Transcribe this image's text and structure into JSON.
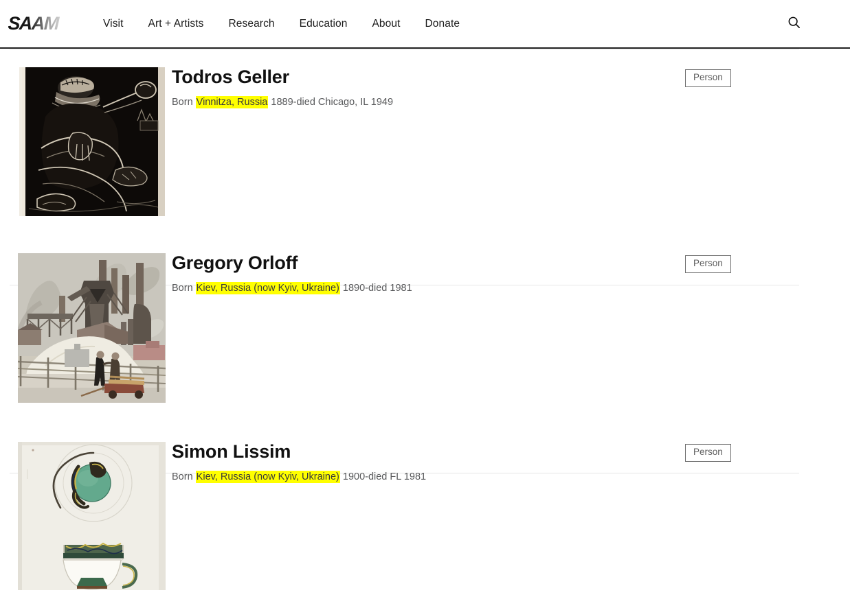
{
  "header": {
    "logo_text": "SAAM",
    "logo_alt": "Smithsonian American Art Museum",
    "nav": [
      {
        "label": "Visit"
      },
      {
        "label": "Art + Artists"
      },
      {
        "label": "Research"
      },
      {
        "label": "Education"
      },
      {
        "label": "About"
      },
      {
        "label": "Donate"
      }
    ],
    "search_icon": "search-icon",
    "search_label": "Search"
  },
  "results": [
    {
      "title": "Todros Geller",
      "born_prefix": "Born",
      "highlight": "Vinnitza, Russia",
      "rest": "1889-died Chicago, IL 1949",
      "badge": "Person",
      "thumb_alt": "Dark woodcut print of a seated figure"
    },
    {
      "title": "Gregory Orloff",
      "born_prefix": "Born",
      "highlight": "Kiev, Russia (now Kyiv, Ukraine)",
      "rest": "1890-died 1981",
      "badge": "Person",
      "thumb_alt": "Painting of an industrial steel mill with smokestacks and two figures at a fence"
    },
    {
      "title": "Simon Lissim",
      "born_prefix": "Born",
      "highlight": "Kiev, Russia (now Kyiv, Ukraine)",
      "rest": "1900-died FL 1981",
      "badge": "Person",
      "thumb_alt": "Ceramic design drawing of a saucer with green motif and a teacup"
    }
  ],
  "colors": {
    "highlight": "#ffff00",
    "text": "#111111",
    "muted": "#57585a",
    "border": "#e6e6e6",
    "logo_dark": "#111111",
    "logo_light": "#bdbdbd"
  }
}
